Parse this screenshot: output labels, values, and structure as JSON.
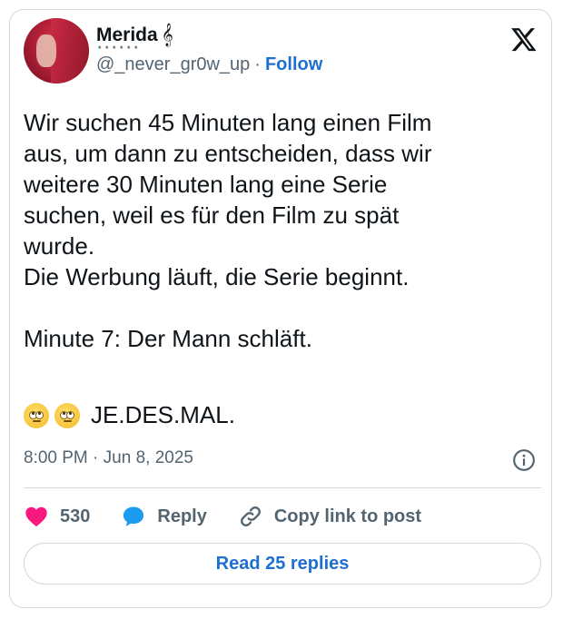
{
  "author": {
    "name": "Merida",
    "name_symbol": "𝄞",
    "name_decoration": "* * * * * *",
    "handle": "@_never_gr0w_up",
    "separator": "·",
    "follow_label": "Follow"
  },
  "tweet": {
    "text": "Wir suchen 45 Minuten lang einen Film\naus, um dann zu entscheiden, dass wir\nweitere 30 Minuten lang eine Serie\nsuchen, weil es für den Film zu spät\nwurde.\nDie Werbung läuft, die Serie beginnt.\n\nMinute 7: Der Mann schläft.",
    "final_line": "JE.DES.MAL.",
    "emoji_name": "face-with-rolling-eyes"
  },
  "meta": {
    "time": "8:00 PM",
    "separator": "·",
    "date": "Jun 8, 2025"
  },
  "actions": {
    "likes": "530",
    "reply_label": "Reply",
    "copy_label": "Copy link to post"
  },
  "read_replies_label": "Read 25 replies",
  "colors": {
    "like": "#f91880",
    "reply": "#1d9bf0",
    "link": "#1d6fd1",
    "muted": "#536471",
    "border": "#cfd9de"
  }
}
